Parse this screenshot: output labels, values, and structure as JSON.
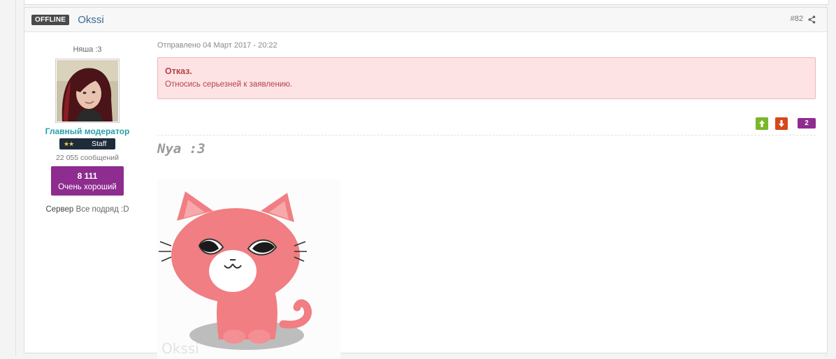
{
  "post": {
    "status": "OFFLINE",
    "author": "Okssi",
    "number": "#82",
    "date": "Отправлено 04 Март 2017 - 20:22"
  },
  "user": {
    "title": "Няша :3",
    "group": "Главный модератор",
    "badge": "Staff",
    "post_count": "22 055 сообщений",
    "reputation": {
      "value": "8 111",
      "label": "Очень хороший"
    },
    "server_label": "Сервер",
    "server_value": "Все подряд :D"
  },
  "alert": {
    "title": "Отказ.",
    "text": "Относись серьезней к заявлению."
  },
  "votes": {
    "count": "2"
  },
  "signature": {
    "text": "Nya :3",
    "image_watermark": "Okssi"
  },
  "colors": {
    "accent_purple": "#8e2c8f",
    "group_teal": "#27a0a8",
    "alert_bg": "#fde3e4",
    "vote_up": "#7ab72a",
    "vote_down": "#d6481a"
  },
  "icons": [
    "share-icon",
    "arrow-up-icon",
    "arrow-down-icon"
  ]
}
